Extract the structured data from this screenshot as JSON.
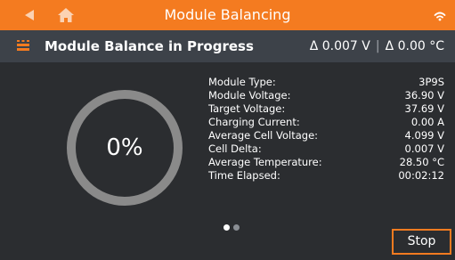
{
  "topbar": {
    "title": "Module Balancing",
    "icons": [
      "back-arrow-icon",
      "home-icon",
      "wifi-icon"
    ]
  },
  "subheader": {
    "icon": "battery-module-icon",
    "title": "Module Balance in Progress",
    "voltage_delta": "Δ 0.007 V",
    "separator": "|",
    "temperature_delta": "Δ 0.00 °C"
  },
  "gauge": {
    "label": "0%",
    "progress": 0
  },
  "stats": [
    {
      "label": "Module Type:",
      "value": "3P9S"
    },
    {
      "label": "Module Voltage:",
      "value": "36.90 V"
    },
    {
      "label": "Target Voltage:",
      "value": "37.69 V"
    },
    {
      "label": "Charging Current:",
      "value": "0.00 A"
    },
    {
      "label": "Average Cell Voltage:",
      "value": "4.099 V"
    },
    {
      "label": "Cell Delta:",
      "value": "0.007 V"
    },
    {
      "label": "Average Temperature:",
      "value": "28.50 °C"
    },
    {
      "label": "Time Elapsed:",
      "value": "00:02:12"
    }
  ],
  "pager": {
    "pages": 2,
    "current": 1
  },
  "actions": {
    "stop_label": "Stop"
  },
  "colors": {
    "accent": "#f47b20",
    "background": "#2b2d30",
    "subheader": "#3d4249",
    "gauge_track": "#8a8a8a"
  }
}
